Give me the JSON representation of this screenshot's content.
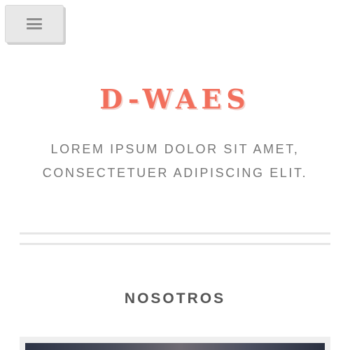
{
  "header": {
    "menu_icon": "hamburger-menu-icon"
  },
  "hero": {
    "title": "D-WAES",
    "tagline_line1": "LOREM IPSUM DOLOR SIT AMET,",
    "tagline_line2": "CONSECTETUER ADIPISCING ELIT."
  },
  "sections": {
    "about_heading": "NOSOTROS"
  },
  "colors": {
    "accent": "#f26f5c",
    "text_muted": "#777777",
    "heading": "#555555",
    "divider": "#e6e6e6"
  }
}
